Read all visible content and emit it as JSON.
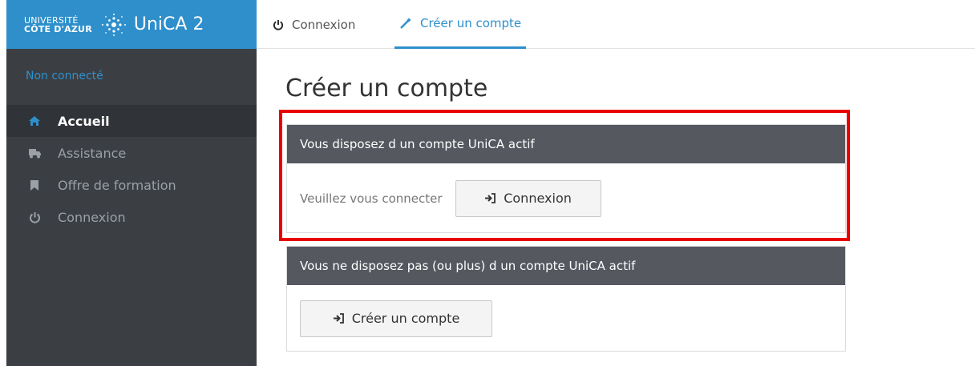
{
  "brand": {
    "line1": "UNIVERSITÉ",
    "line2": "CÔTE D'AZUR",
    "name": "UniCA 2",
    "star_icon": "university-star-logo"
  },
  "sidebar": {
    "status": "Non connecté",
    "items": [
      {
        "label": "Accueil",
        "icon": "home-icon",
        "active": true
      },
      {
        "label": "Assistance",
        "icon": "truck-icon",
        "active": false
      },
      {
        "label": "Offre de formation",
        "icon": "bookmark-icon",
        "active": false
      },
      {
        "label": "Connexion",
        "icon": "power-icon",
        "active": false
      }
    ]
  },
  "tabs": [
    {
      "label": "Connexion",
      "icon": "power-icon",
      "active": false
    },
    {
      "label": "Créer un compte",
      "icon": "magic-wand-icon",
      "active": true
    }
  ],
  "page_title": "Créer un compte",
  "card_active": {
    "header": "Vous disposez d un compte UniCA actif",
    "prompt": "Veuillez vous connecter",
    "button_label": "Connexion",
    "button_icon": "sign-in-icon"
  },
  "card_inactive": {
    "header": "Vous ne disposez pas (ou plus) d un compte UniCA actif",
    "button_label": "Créer un compte",
    "button_icon": "sign-in-icon"
  },
  "colors": {
    "accent": "#2e8fcb",
    "sidebar_bg": "#3b3f44",
    "card_header_bg": "#55585f",
    "highlight": "#e80000"
  }
}
